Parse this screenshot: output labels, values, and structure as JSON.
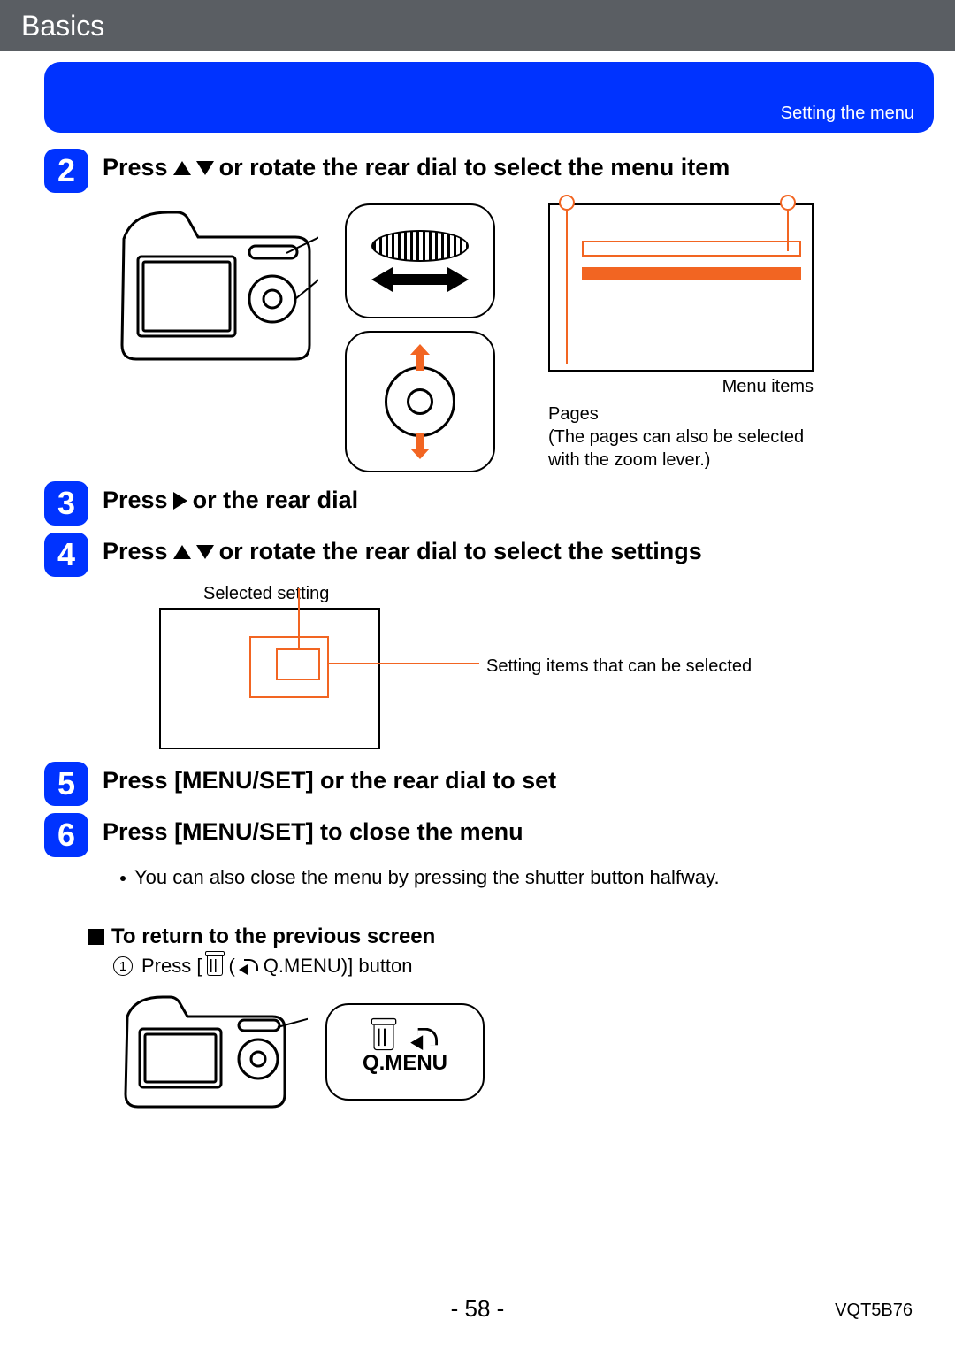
{
  "header": {
    "title": "Basics"
  },
  "blueBlock": {
    "subtitle": "Setting the menu"
  },
  "steps": {
    "s2": {
      "num": "2",
      "pre": "Press",
      "post": "or rotate the rear dial to select the menu item"
    },
    "s3": {
      "num": "3",
      "pre": "Press",
      "post": "or the rear dial"
    },
    "s4": {
      "num": "4",
      "pre": "Press",
      "post": "or rotate the rear dial to select the settings"
    },
    "s5": {
      "num": "5",
      "text": "Press [MENU/SET] or the rear dial to set"
    },
    "s6": {
      "num": "6",
      "text": "Press [MENU/SET] to close the menu"
    }
  },
  "menuDiagram": {
    "menuItems": "Menu items",
    "pages": "Pages",
    "pagesNote": "(The pages can also be selected with the zoom lever.)"
  },
  "settingsDiagram": {
    "topLabel": "Selected setting",
    "sideLabel": "Setting items that can be selected"
  },
  "step6Note": "You can also close the menu by pressing the shutter button halfway.",
  "returnSection": {
    "heading": "To return to the previous screen",
    "linePre": "Press [",
    "lineMid": " (",
    "qmenu": " Q.MENU)] button",
    "calloutLabel": "Q.MENU"
  },
  "footer": {
    "page": "- 58 -",
    "docId": "VQT5B76"
  }
}
